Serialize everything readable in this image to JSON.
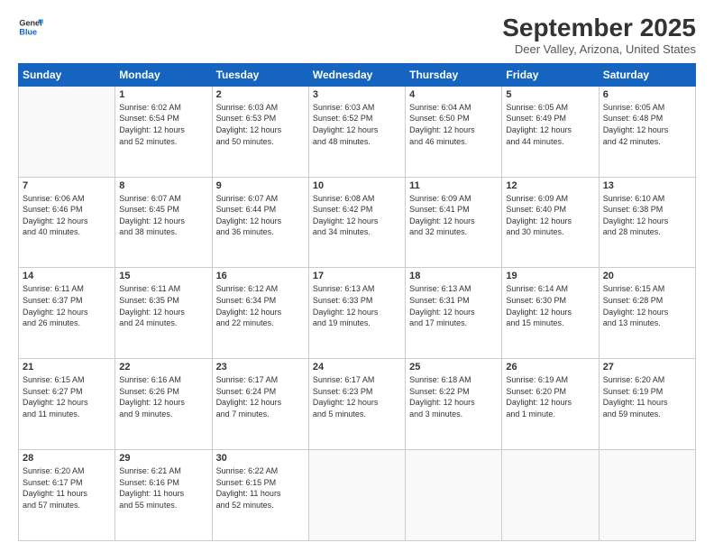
{
  "header": {
    "logo_line1": "General",
    "logo_line2": "Blue",
    "month_title": "September 2025",
    "location": "Deer Valley, Arizona, United States"
  },
  "days_of_week": [
    "Sunday",
    "Monday",
    "Tuesday",
    "Wednesday",
    "Thursday",
    "Friday",
    "Saturday"
  ],
  "weeks": [
    [
      {
        "day": "",
        "info": ""
      },
      {
        "day": "1",
        "info": "Sunrise: 6:02 AM\nSunset: 6:54 PM\nDaylight: 12 hours\nand 52 minutes."
      },
      {
        "day": "2",
        "info": "Sunrise: 6:03 AM\nSunset: 6:53 PM\nDaylight: 12 hours\nand 50 minutes."
      },
      {
        "day": "3",
        "info": "Sunrise: 6:03 AM\nSunset: 6:52 PM\nDaylight: 12 hours\nand 48 minutes."
      },
      {
        "day": "4",
        "info": "Sunrise: 6:04 AM\nSunset: 6:50 PM\nDaylight: 12 hours\nand 46 minutes."
      },
      {
        "day": "5",
        "info": "Sunrise: 6:05 AM\nSunset: 6:49 PM\nDaylight: 12 hours\nand 44 minutes."
      },
      {
        "day": "6",
        "info": "Sunrise: 6:05 AM\nSunset: 6:48 PM\nDaylight: 12 hours\nand 42 minutes."
      }
    ],
    [
      {
        "day": "7",
        "info": "Sunrise: 6:06 AM\nSunset: 6:46 PM\nDaylight: 12 hours\nand 40 minutes."
      },
      {
        "day": "8",
        "info": "Sunrise: 6:07 AM\nSunset: 6:45 PM\nDaylight: 12 hours\nand 38 minutes."
      },
      {
        "day": "9",
        "info": "Sunrise: 6:07 AM\nSunset: 6:44 PM\nDaylight: 12 hours\nand 36 minutes."
      },
      {
        "day": "10",
        "info": "Sunrise: 6:08 AM\nSunset: 6:42 PM\nDaylight: 12 hours\nand 34 minutes."
      },
      {
        "day": "11",
        "info": "Sunrise: 6:09 AM\nSunset: 6:41 PM\nDaylight: 12 hours\nand 32 minutes."
      },
      {
        "day": "12",
        "info": "Sunrise: 6:09 AM\nSunset: 6:40 PM\nDaylight: 12 hours\nand 30 minutes."
      },
      {
        "day": "13",
        "info": "Sunrise: 6:10 AM\nSunset: 6:38 PM\nDaylight: 12 hours\nand 28 minutes."
      }
    ],
    [
      {
        "day": "14",
        "info": "Sunrise: 6:11 AM\nSunset: 6:37 PM\nDaylight: 12 hours\nand 26 minutes."
      },
      {
        "day": "15",
        "info": "Sunrise: 6:11 AM\nSunset: 6:35 PM\nDaylight: 12 hours\nand 24 minutes."
      },
      {
        "day": "16",
        "info": "Sunrise: 6:12 AM\nSunset: 6:34 PM\nDaylight: 12 hours\nand 22 minutes."
      },
      {
        "day": "17",
        "info": "Sunrise: 6:13 AM\nSunset: 6:33 PM\nDaylight: 12 hours\nand 19 minutes."
      },
      {
        "day": "18",
        "info": "Sunrise: 6:13 AM\nSunset: 6:31 PM\nDaylight: 12 hours\nand 17 minutes."
      },
      {
        "day": "19",
        "info": "Sunrise: 6:14 AM\nSunset: 6:30 PM\nDaylight: 12 hours\nand 15 minutes."
      },
      {
        "day": "20",
        "info": "Sunrise: 6:15 AM\nSunset: 6:28 PM\nDaylight: 12 hours\nand 13 minutes."
      }
    ],
    [
      {
        "day": "21",
        "info": "Sunrise: 6:15 AM\nSunset: 6:27 PM\nDaylight: 12 hours\nand 11 minutes."
      },
      {
        "day": "22",
        "info": "Sunrise: 6:16 AM\nSunset: 6:26 PM\nDaylight: 12 hours\nand 9 minutes."
      },
      {
        "day": "23",
        "info": "Sunrise: 6:17 AM\nSunset: 6:24 PM\nDaylight: 12 hours\nand 7 minutes."
      },
      {
        "day": "24",
        "info": "Sunrise: 6:17 AM\nSunset: 6:23 PM\nDaylight: 12 hours\nand 5 minutes."
      },
      {
        "day": "25",
        "info": "Sunrise: 6:18 AM\nSunset: 6:22 PM\nDaylight: 12 hours\nand 3 minutes."
      },
      {
        "day": "26",
        "info": "Sunrise: 6:19 AM\nSunset: 6:20 PM\nDaylight: 12 hours\nand 1 minute."
      },
      {
        "day": "27",
        "info": "Sunrise: 6:20 AM\nSunset: 6:19 PM\nDaylight: 11 hours\nand 59 minutes."
      }
    ],
    [
      {
        "day": "28",
        "info": "Sunrise: 6:20 AM\nSunset: 6:17 PM\nDaylight: 11 hours\nand 57 minutes."
      },
      {
        "day": "29",
        "info": "Sunrise: 6:21 AM\nSunset: 6:16 PM\nDaylight: 11 hours\nand 55 minutes."
      },
      {
        "day": "30",
        "info": "Sunrise: 6:22 AM\nSunset: 6:15 PM\nDaylight: 11 hours\nand 52 minutes."
      },
      {
        "day": "",
        "info": ""
      },
      {
        "day": "",
        "info": ""
      },
      {
        "day": "",
        "info": ""
      },
      {
        "day": "",
        "info": ""
      }
    ]
  ]
}
